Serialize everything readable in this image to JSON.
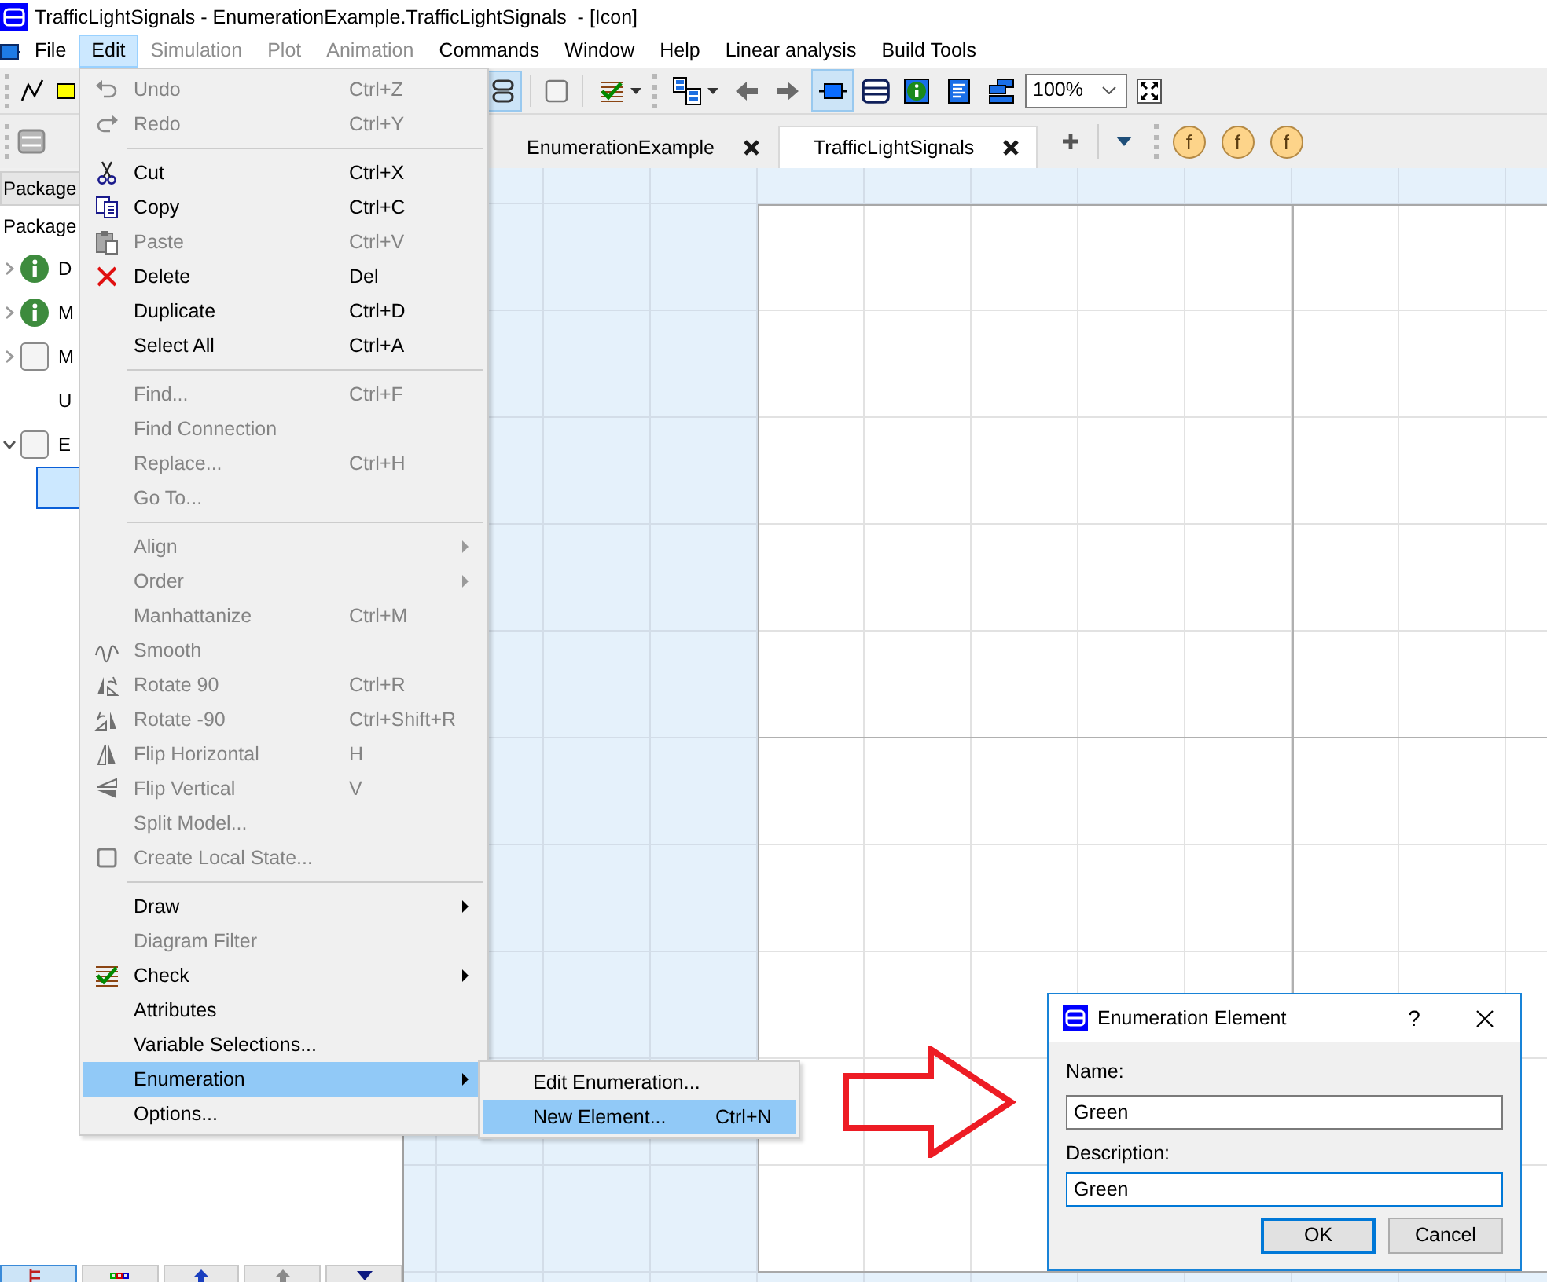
{
  "window": {
    "title": "TrafficLightSignals - EnumerationExample.TrafficLightSignals  - [Icon]"
  },
  "menu_bar": [
    {
      "label": "File",
      "selected": false,
      "disabled": false
    },
    {
      "label": "Edit",
      "selected": true,
      "disabled": false
    },
    {
      "label": "Simulation",
      "selected": false,
      "disabled": true
    },
    {
      "label": "Plot",
      "selected": false,
      "disabled": true
    },
    {
      "label": "Animation",
      "selected": false,
      "disabled": true
    },
    {
      "label": "Commands",
      "selected": false,
      "disabled": false
    },
    {
      "label": "Window",
      "selected": false,
      "disabled": false
    },
    {
      "label": "Help",
      "selected": false,
      "disabled": false
    },
    {
      "label": "Linear analysis",
      "selected": false,
      "disabled": false
    },
    {
      "label": "Build Tools",
      "selected": false,
      "disabled": false
    }
  ],
  "toolbar": {
    "buttons": [
      {
        "selected": false
      },
      {
        "selected": false
      },
      {
        "selected": true
      },
      {
        "selected": false
      },
      {
        "selected": false
      },
      {
        "selected": false
      },
      {
        "selected": false
      },
      {
        "selected": false
      },
      {
        "selected": true
      },
      {
        "selected": false
      },
      {
        "selected": false
      },
      {
        "selected": false
      },
      {
        "selected": false
      },
      {
        "selected": false
      }
    ],
    "zoom": "100%"
  },
  "tabs": [
    {
      "label": "EnumerationExample",
      "selected": false
    },
    {
      "label": "TrafficLightSignals",
      "selected": true
    }
  ],
  "function_buttons": [
    {
      "label": "f"
    },
    {
      "label": "f"
    },
    {
      "label": "f"
    }
  ],
  "package_browser": {
    "tab": "Package",
    "header": "Package",
    "tree": [
      {
        "label": "D",
        "kind": "info",
        "expanded": false,
        "selected": false
      },
      {
        "label": "M",
        "kind": "info",
        "expanded": false,
        "selected": false
      },
      {
        "label": "M",
        "kind": "class",
        "expanded": false,
        "selected": false
      },
      {
        "label": "U",
        "kind": "plain",
        "selected": false
      },
      {
        "label": "E",
        "kind": "class",
        "expanded": true,
        "selected": false,
        "children": [
          {
            "selected": true
          }
        ]
      }
    ],
    "bottom_tabs": [
      {
        "selected": true
      },
      {
        "selected": false
      },
      {
        "selected": false
      },
      {
        "selected": false
      },
      {
        "selected": false
      }
    ]
  },
  "edit_menu": {
    "sections": [
      [
        {
          "label": "Undo",
          "shortcut": "Ctrl+Z",
          "disabled": true,
          "selected": false,
          "submenu": false
        },
        {
          "label": "Redo",
          "shortcut": "Ctrl+Y",
          "disabled": true,
          "selected": false,
          "submenu": false
        }
      ],
      [
        {
          "label": "Cut",
          "shortcut": "Ctrl+X",
          "disabled": false,
          "selected": false,
          "submenu": false
        },
        {
          "label": "Copy",
          "shortcut": "Ctrl+C",
          "disabled": false,
          "selected": false,
          "submenu": false
        },
        {
          "label": "Paste",
          "shortcut": "Ctrl+V",
          "disabled": true,
          "selected": false,
          "submenu": false
        },
        {
          "label": "Delete",
          "shortcut": "Del",
          "disabled": false,
          "selected": false,
          "submenu": false
        },
        {
          "label": "Duplicate",
          "shortcut": "Ctrl+D",
          "disabled": false,
          "selected": false,
          "submenu": false
        },
        {
          "label": "Select All",
          "shortcut": "Ctrl+A",
          "disabled": false,
          "selected": false,
          "submenu": false
        }
      ],
      [
        {
          "label": "Find...",
          "shortcut": "Ctrl+F",
          "disabled": true,
          "selected": false,
          "submenu": false
        },
        {
          "label": "Find Connection",
          "disabled": true,
          "selected": false,
          "submenu": false
        },
        {
          "label": "Replace...",
          "shortcut": "Ctrl+H",
          "disabled": true,
          "selected": false,
          "submenu": false
        },
        {
          "label": "Go To...",
          "disabled": true,
          "selected": false,
          "submenu": false
        }
      ],
      [
        {
          "label": "Align",
          "disabled": true,
          "selected": false,
          "submenu": true
        },
        {
          "label": "Order",
          "disabled": true,
          "selected": false,
          "submenu": true
        },
        {
          "label": "Manhattanize",
          "shortcut": "Ctrl+M",
          "disabled": true,
          "selected": false,
          "submenu": false
        },
        {
          "label": "Smooth",
          "disabled": true,
          "selected": false,
          "submenu": false
        },
        {
          "label": "Rotate 90",
          "shortcut": "Ctrl+R",
          "disabled": true,
          "selected": false,
          "submenu": false
        },
        {
          "label": "Rotate -90",
          "shortcut": "Ctrl+Shift+R",
          "disabled": true,
          "selected": false,
          "submenu": false
        },
        {
          "label": "Flip Horizontal",
          "shortcut": "H",
          "disabled": true,
          "selected": false,
          "submenu": false
        },
        {
          "label": "Flip Vertical",
          "shortcut": "V",
          "disabled": true,
          "selected": false,
          "submenu": false
        },
        {
          "label": "Split Model...",
          "disabled": true,
          "selected": false,
          "submenu": false
        },
        {
          "label": "Create Local State...",
          "disabled": true,
          "selected": false,
          "submenu": false
        }
      ],
      [
        {
          "label": "Draw",
          "disabled": false,
          "selected": false,
          "submenu": true
        },
        {
          "label": "Diagram Filter",
          "disabled": true,
          "selected": false,
          "submenu": false
        },
        {
          "label": "Check",
          "disabled": false,
          "selected": false,
          "submenu": true
        },
        {
          "label": "Attributes",
          "disabled": false,
          "selected": false,
          "submenu": false
        },
        {
          "label": "Variable Selections...",
          "disabled": false,
          "selected": false,
          "submenu": false
        },
        {
          "label": "Enumeration",
          "disabled": false,
          "selected": true,
          "submenu": true
        },
        {
          "label": "Options...",
          "disabled": false,
          "selected": false,
          "submenu": false
        }
      ]
    ]
  },
  "enumeration_submenu": [
    {
      "label": "Edit Enumeration...",
      "selected": false
    },
    {
      "label": "New Element...",
      "shortcut": "Ctrl+N",
      "selected": true
    }
  ],
  "dialog": {
    "title": "Enumeration Element",
    "help": "?",
    "fields": [
      {
        "label": "Name:",
        "value": "Green",
        "focused": false
      },
      {
        "label": "Description:",
        "value": "Green",
        "focused": true
      }
    ],
    "buttons": [
      {
        "label": "OK",
        "default": true
      },
      {
        "label": "Cancel",
        "default": false
      }
    ]
  }
}
